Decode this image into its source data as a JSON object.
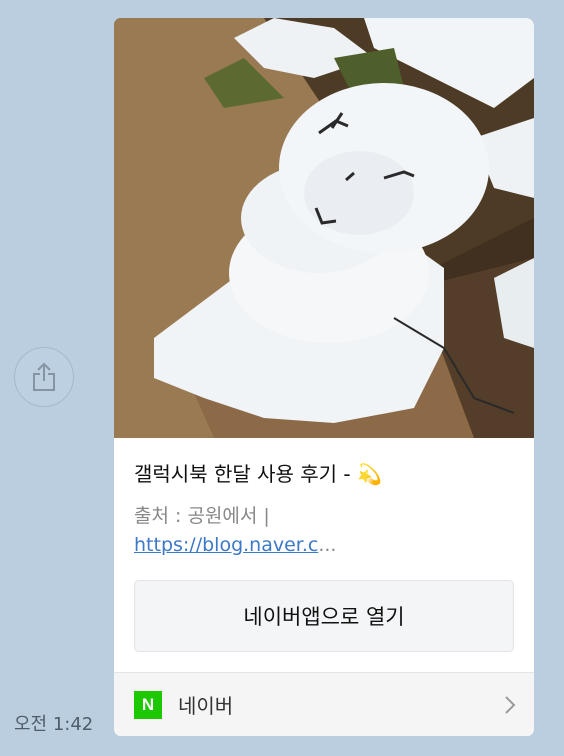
{
  "message": {
    "timestamp": "오전 1:42",
    "share_icon": "share-icon"
  },
  "link_card": {
    "image_alt": "snowman photo",
    "title": "갤럭시북 한달 사용 후기 - 💫",
    "source_prefix": "출처 : 공원에서 | ",
    "source_link": "https://blog.naver.c",
    "source_ellipsis": "...",
    "open_button_label": "네이버앱으로 열기",
    "footer": {
      "logo_letter": "N",
      "label": "네이버",
      "chevron_icon": "chevron-right-icon"
    }
  },
  "colors": {
    "chat_background": "#bacee0",
    "naver_green": "#1ec800",
    "link_blue": "#3c78c8"
  }
}
